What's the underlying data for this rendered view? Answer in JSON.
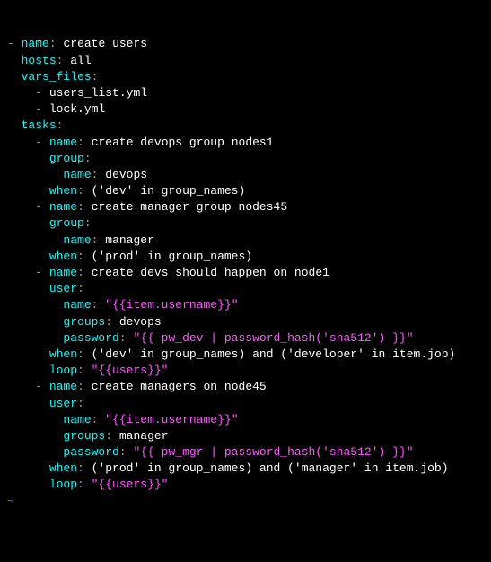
{
  "dash": "-",
  "colon": ":",
  "sp": " ",
  "name_key": "name",
  "hosts_key": "hosts",
  "vars_files_key": "vars_files",
  "tasks_key": "tasks",
  "group_key": "group",
  "user_key": "user",
  "groups_key": "groups",
  "password_key": "password",
  "when_key": "when",
  "loop_key": "loop",
  "play_name": "create users",
  "hosts_val": "all",
  "vf1": "users_list.yml",
  "vf2": "lock.yml",
  "t1_name": "create devops group nodes1",
  "t1_group_name": "devops",
  "t1_when": "('dev' in group_names)",
  "t2_name": "create manager group nodes45",
  "t2_group_name": "manager",
  "t2_when": "('prod' in group_names)",
  "t3_name": "create devs should happen on node1",
  "t3_user_name": "\"{{item.username}}\"",
  "t3_groups": "devops",
  "t3_password": "\"{{ pw_dev | password_hash('sha512') }}\"",
  "t3_when": "('dev' in group_names) and ('developer' in item.job)",
  "t3_loop": "\"{{users}}\"",
  "t4_name": "create managers on node45",
  "t4_user_name": "\"{{item.username}}\"",
  "t4_groups": "manager",
  "t4_password": "\"{{ pw_mgr | password_hash('sha512') }}\"",
  "t4_when": "('prod' in group_names) and ('manager' in item.job)",
  "t4_loop": "\"{{users}}\"",
  "tilde": "~"
}
